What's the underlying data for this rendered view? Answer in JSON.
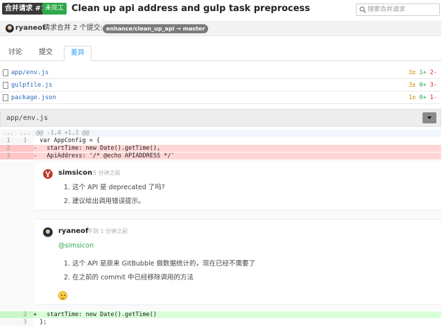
{
  "header": {
    "pr_number": "合并请求 #1",
    "status": "未完工",
    "title": "Clean up api address and gulp task preprocess",
    "search_placeholder": "搜索合并请求"
  },
  "meta": {
    "user": "ryaneof",
    "text": "请求合并 2 个提交:",
    "branch": "enhance/clean_up_api → master"
  },
  "tabs": [
    {
      "label": "讨论"
    },
    {
      "label": "提交"
    },
    {
      "label": "差异"
    }
  ],
  "files": [
    {
      "name": "app/env.js",
      "changed": "3±",
      "added": "1+",
      "deleted": "2-"
    },
    {
      "name": "gulpfile.js",
      "changed": "3±",
      "added": "0+",
      "deleted": "3-"
    },
    {
      "name": "package.json",
      "changed": "1±",
      "added": "0+",
      "deleted": "1-"
    }
  ],
  "diff": {
    "file": "app/env.js",
    "hunk_dots1": "...",
    "hunk_dots2": "...",
    "hunk": "@@ -1,4 +1,3 @@",
    "lines": [
      {
        "old": "1",
        "new": "1",
        "sign": "",
        "code": " var AppConfig = {"
      },
      {
        "old": "2",
        "new": "",
        "sign": "-",
        "code": "   startTime: new Date().getTime(),"
      },
      {
        "old": "3",
        "new": "",
        "sign": "-",
        "code": "   ApiAddress: '/* @echo APIADDRESS */'"
      },
      {
        "old": "",
        "new": "2",
        "sign": "+",
        "code": "   startTime: new Date().getTime()"
      },
      {
        "old": "",
        "new": "3",
        "sign": "",
        "code": " };"
      }
    ]
  },
  "comments": [
    {
      "author": "simsicon",
      "time": "5 分钟之前",
      "items": [
        "1.  这个 API 是 deprecated 了吗?",
        "2.  建议给出调用错误提示。"
      ]
    },
    {
      "author": "ryaneof",
      "time": "不到 1 分钟之前",
      "mention": "@simsicon",
      "items": [
        "1.  这个 API 是原来 GitBubble 做数据统计的，现在已经不需要了",
        "2.  在之前的 commit 中已经移除调用的方法"
      ]
    }
  ],
  "colors": {
    "accent": "#2a9df4",
    "status_green": "#2ea84a",
    "deleted_bg": "#ffd6d6",
    "added_bg": "#d9ffd9"
  }
}
